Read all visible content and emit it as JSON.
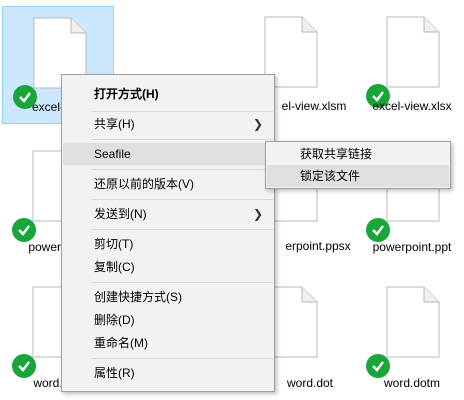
{
  "files": [
    {
      "name": "excel-view.xlsb",
      "label": "excel-v",
      "selected": true
    },
    {
      "name": "excel-view.xlsm",
      "label": "el-view.xlsm",
      "selected": false
    },
    {
      "name": "excel-view.xlsx",
      "label": "excel-view.xlsx",
      "selected": false
    },
    {
      "name": "powerpoint.ppt",
      "label": "powerp",
      "selected": false
    },
    {
      "name": "powerpoint.ppsx",
      "label": "erpoint.ppsx",
      "selected": false
    },
    {
      "name": "powerpoint.ppt",
      "label": "powerpoint.ppt",
      "selected": false
    },
    {
      "name": "word.doc",
      "label": "word.",
      "selected": false
    },
    {
      "name": "word.dot",
      "label": "word.dot",
      "selected": false
    },
    {
      "name": "word.dotm",
      "label": "word.dotm",
      "selected": false
    }
  ],
  "context_menu": {
    "open_with": "打开方式(H)",
    "share": "共享(H)",
    "seafile": "Seafile",
    "restore_previous": "还原以前的版本(V)",
    "send_to": "发送到(N)",
    "cut": "剪切(T)",
    "copy": "复制(C)",
    "create_shortcut": "创建快捷方式(S)",
    "delete": "删除(D)",
    "rename": "重命名(M)",
    "properties": "属性(R)"
  },
  "seafile_submenu": {
    "get_share_link": "获取共享链接",
    "lock_file": "锁定该文件"
  },
  "colors": {
    "sync_check": "#1aa53b",
    "selection": "#cce8ff",
    "menu_bg": "#f2f2f2"
  }
}
